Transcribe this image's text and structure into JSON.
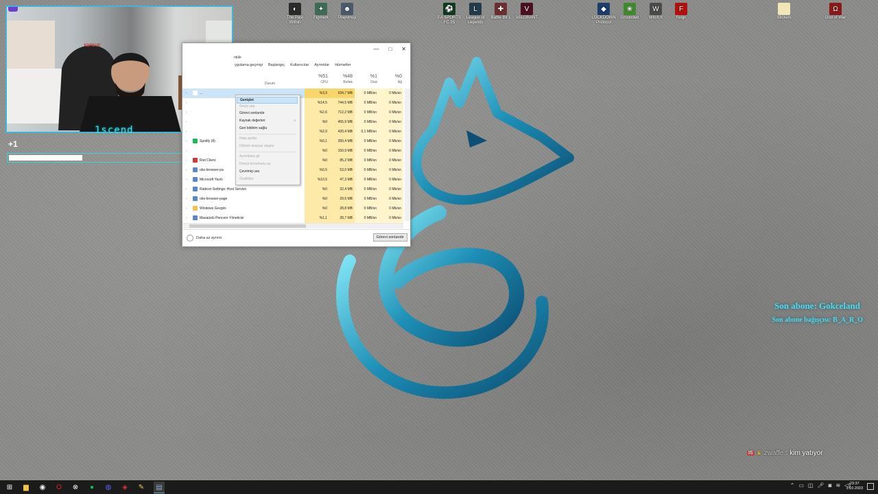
{
  "desktop_icons": [
    {
      "label": "The Past Within",
      "icon": "game-icon",
      "color": "#2b2b2b",
      "glyph": "◐"
    },
    {
      "label": "Figment",
      "icon": "game-icon",
      "color": "#3e6b55",
      "glyph": "✦"
    },
    {
      "label": "Playomoji",
      "icon": "game-icon",
      "color": "#4a5a6b",
      "glyph": "☻"
    },
    {
      "label": "EA SPORTS FC 25",
      "icon": "game-icon",
      "color": "#0f3d1f",
      "glyph": "⚽"
    },
    {
      "label": "League of Legends",
      "icon": "game-icon",
      "color": "#233a4a",
      "glyph": "L"
    },
    {
      "label": "Battle Bit 1",
      "icon": "game-icon",
      "color": "#6b2f2f",
      "glyph": "✚"
    },
    {
      "label": "VALORANT",
      "icon": "game-icon",
      "color": "#4a1020",
      "glyph": "V"
    },
    {
      "label": "LOCKDOWN Protocol",
      "icon": "game-icon",
      "color": "#1d3d6b",
      "glyph": "◆"
    },
    {
      "label": "Grounded",
      "icon": "game-icon",
      "color": "#3f8a2f",
      "glyph": "❀"
    },
    {
      "label": "Witch It",
      "icon": "game-icon",
      "color": "#4b4b4b",
      "glyph": "W"
    },
    {
      "label": "Feign",
      "icon": "game-icon",
      "color": "#b01010",
      "glyph": "F"
    },
    {
      "label": "Stickers",
      "icon": "file-icon",
      "color": "#f1e6b5",
      "glyph": ""
    },
    {
      "label": "God of War",
      "icon": "game-icon",
      "color": "#8a1a1a",
      "glyph": "Ω"
    }
  ],
  "webcam": {
    "streamer_name": "1scend",
    "chair_brand": "XDREVE"
  },
  "alert": {
    "count": "+1",
    "progress": 0.33
  },
  "task_manager": {
    "menu_visible": "ntüle",
    "tabs": [
      "ygulama geçmişi",
      "Başlangıç",
      "Kullanıcılar",
      "Ayrıntılar",
      "Hizmetler"
    ],
    "status_header": "Durum",
    "stats": [
      {
        "pct": "%51",
        "label": "CPU"
      },
      {
        "pct": "%48",
        "label": "Bellek"
      },
      {
        "pct": "%1",
        "label": "Disk"
      },
      {
        "pct": "%0",
        "label": "Ağ"
      }
    ],
    "rows": [
      {
        "name": "...",
        "icon_color": "#ffffff",
        "cpu": "%3,9",
        "mem": "934,7 MB",
        "disk": "0 MB/sn",
        "net": "0 Mb/sn",
        "selected": true
      },
      {
        "name": "",
        "icon_color": "#ffffff",
        "cpu": "%14,5",
        "mem": "744,5 MB",
        "disk": "0 MB/sn",
        "net": "0 Mb/sn",
        "selected": false
      },
      {
        "name": "",
        "icon_color": "#ffffff",
        "cpu": "%2,6",
        "mem": "712,2 MB",
        "disk": "0 MB/sn",
        "net": "0 Mb/sn",
        "selected": false
      },
      {
        "name": "",
        "icon_color": "#ffffff",
        "cpu": "%0",
        "mem": "455,9 MB",
        "disk": "0 MB/sn",
        "net": "0 Mb/sn",
        "selected": false
      },
      {
        "name": "",
        "icon_color": "#ffffff",
        "cpu": "%2,0",
        "mem": "420,4 MB",
        "disk": "0,1 MB/sn",
        "net": "0 Mb/sn",
        "selected": false
      },
      {
        "name": "Spotify (8)",
        "icon_color": "#1db954",
        "cpu": "%0,1",
        "mem": "350,4 MB",
        "disk": "0 MB/sn",
        "net": "0 Mb/sn",
        "selected": false
      },
      {
        "name": "",
        "icon_color": "#ffffff",
        "cpu": "%0",
        "mem": "150,9 MB",
        "disk": "0 MB/sn",
        "net": "0 Mb/sn",
        "selected": false
      },
      {
        "name": "Riot Client",
        "icon_color": "#d13639",
        "cpu": "%0",
        "mem": "85,2 MB",
        "disk": "0 MB/sn",
        "net": "0 Mb/sn",
        "selected": false
      },
      {
        "name": "obs-browser-pa",
        "icon_color": "#5b86c7",
        "cpu": "%0,5",
        "mem": "53,0 MB",
        "disk": "0 MB/sn",
        "net": "0 Mb/sn",
        "selected": false
      },
      {
        "name": "Microsoft Yazılı",
        "icon_color": "#5b86c7",
        "cpu": "%10,5",
        "mem": "47,3 MB",
        "disk": "0 MB/sn",
        "net": "0 Mb/sn",
        "selected": false
      },
      {
        "name": "Radeon Settings: Host Service",
        "icon_color": "#5b86c7",
        "cpu": "%0",
        "mem": "32,4 MB",
        "disk": "0 MB/sn",
        "net": "0 Mb/sn",
        "selected": false
      },
      {
        "name": "obs-browser-page",
        "icon_color": "#5b86c7",
        "cpu": "%0",
        "mem": "29,6 MB",
        "disk": "0 MB/sn",
        "net": "0 Mb/sn",
        "selected": false
      },
      {
        "name": "Windows Gezgini",
        "icon_color": "#f2c14e",
        "cpu": "%0",
        "mem": "28,8 MB",
        "disk": "0 MB/sn",
        "net": "0 Mb/sn",
        "selected": false
      },
      {
        "name": "Masaüstü Pencere Yöneticisi",
        "icon_color": "#5b86c7",
        "cpu": "%1,1",
        "mem": "28,7 MB",
        "disk": "0 MB/sn",
        "net": "0 Mb/sn",
        "selected": false
      }
    ],
    "fewer_details": "Daha az ayrıntı",
    "end_task": "Görevi sonlandır"
  },
  "context_menu": {
    "items": [
      {
        "label": "Genişlet",
        "state": "selected"
      },
      {
        "label": "Geçiş yap",
        "state": "disabled"
      },
      {
        "label": "Görevi sonlandır",
        "state": "normal"
      },
      {
        "label": "Kaynak değerleri",
        "state": "submenu"
      },
      {
        "label": "Geri bildirim sağla",
        "state": "normal"
      },
      {
        "label": "Hata ayıkla",
        "state": "disabled"
      },
      {
        "label": "Döküm dosyası oluştur",
        "state": "disabled"
      },
      {
        "label": "Ayrıntılara git",
        "state": "disabled"
      },
      {
        "label": "Dosya konumunu aç",
        "state": "disabled"
      },
      {
        "label": "Çevrimiçi ara",
        "state": "normal"
      },
      {
        "label": "Özellikler",
        "state": "disabled"
      }
    ],
    "submenu_arrow": "›"
  },
  "overlay": {
    "last_sub": "Son abone: Gokceland",
    "last_gift": "Son abone bağışçısı: B_A_R_O",
    "chat": {
      "badge": "IS",
      "user": "zwaffe",
      "separator": ":",
      "message": "kim yatıyor"
    }
  },
  "taskbar": {
    "icons": [
      "windows-start-icon",
      "file-explorer-icon",
      "obs-icon",
      "opera-icon",
      "spotify-icon",
      "xbox-icon",
      "discord-icon",
      "riot-icon",
      "pen-icon",
      "task-manager-icon"
    ],
    "clock_time": "23:37",
    "clock_date": "1.10.2023"
  }
}
